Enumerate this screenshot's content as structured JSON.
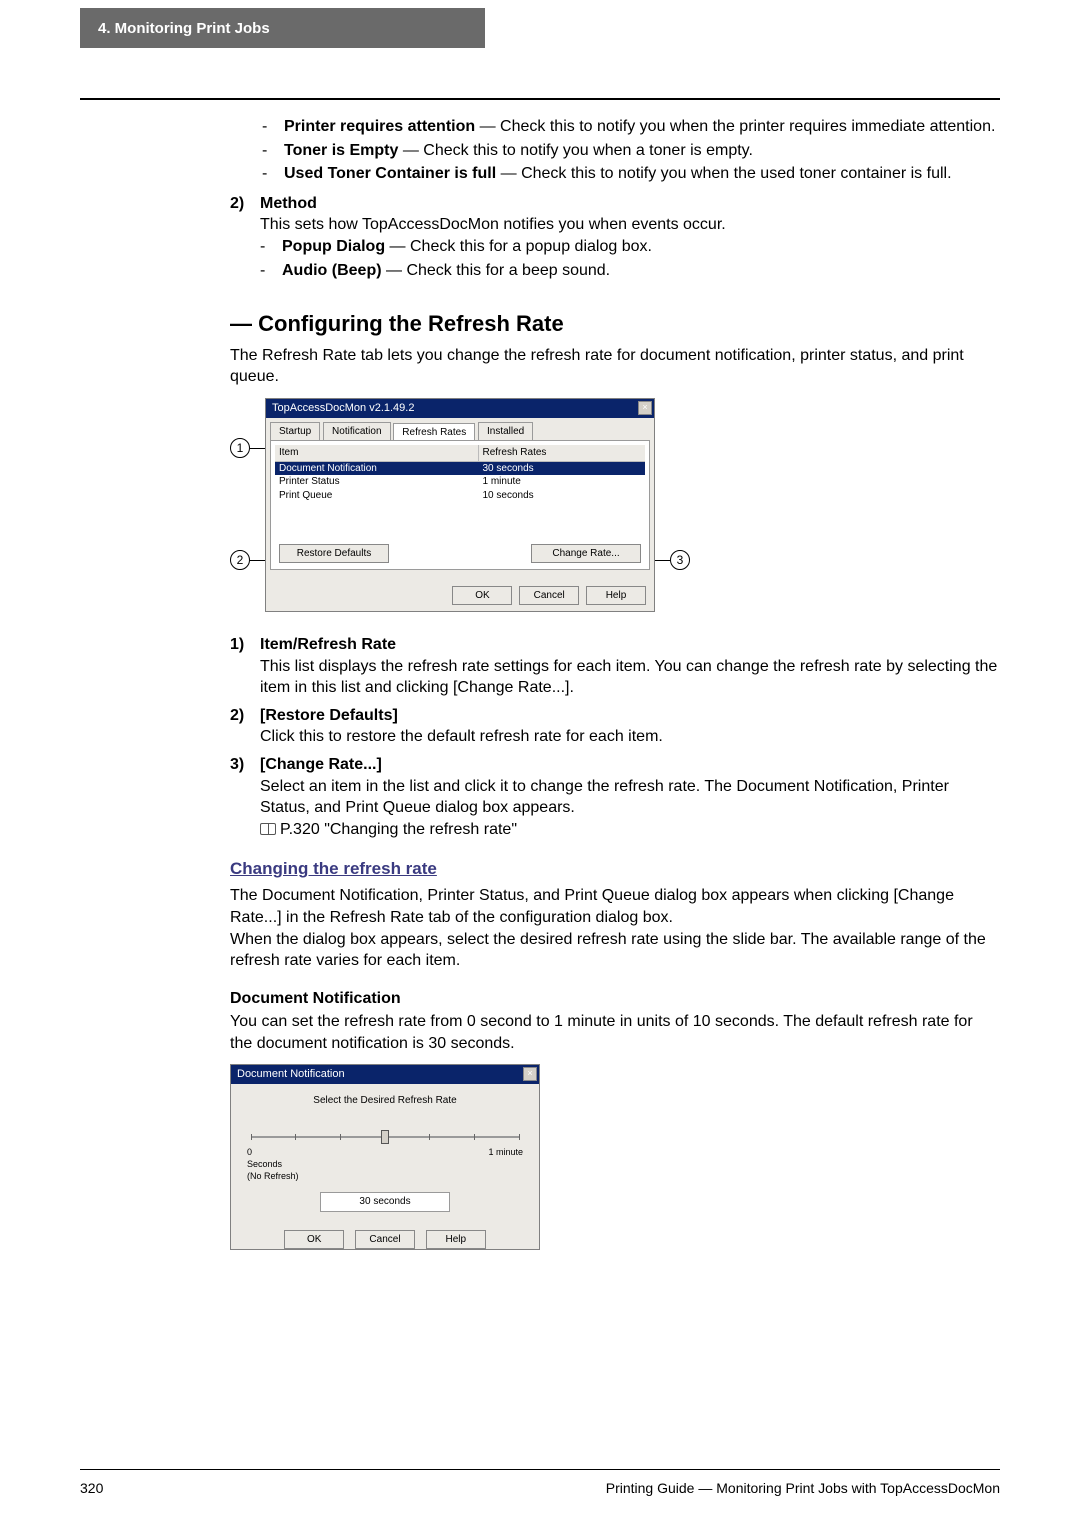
{
  "header": {
    "title": "4.  Monitoring Print Jobs"
  },
  "events": [
    {
      "label": "Printer requires attention",
      "desc": " — Check this to notify you when the printer requires immediate attention."
    },
    {
      "label": "Toner is Empty",
      "desc": " — Check this to notify you when a toner is empty."
    },
    {
      "label": "Used Toner Container is full",
      "desc": " — Check this to notify you when the used toner container is full."
    }
  ],
  "method": {
    "num": "2)",
    "title": "Method",
    "desc": "This sets how TopAccessDocMon notifies you when events occur.",
    "items": [
      {
        "label": "Popup Dialog",
        "desc": " — Check this for a popup dialog box."
      },
      {
        "label": "Audio (Beep)",
        "desc": " — Check this for a beep sound."
      }
    ]
  },
  "section2": {
    "heading": "— Configuring the Refresh Rate",
    "intro": "The Refresh Rate tab lets you change the refresh rate for document notification, printer status, and print queue."
  },
  "dlg1": {
    "title": "TopAccessDocMon  v2.1.49.2",
    "tabs": [
      "Startup",
      "Notification",
      "Refresh Rates",
      "Installed"
    ],
    "active_tab": 2,
    "col1": "Item",
    "col2": "Refresh Rates",
    "rows": [
      {
        "c1": "Document Notification",
        "c2": "30 seconds",
        "selected": true
      },
      {
        "c1": "Printer Status",
        "c2": "1 minute",
        "selected": false
      },
      {
        "c1": "Print Queue",
        "c2": "10 seconds",
        "selected": false
      }
    ],
    "restore": "Restore Defaults",
    "change": "Change Rate...",
    "ok": "OK",
    "cancel": "Cancel",
    "help": "Help",
    "callouts": {
      "c1": "1",
      "c2": "2",
      "c3": "3"
    }
  },
  "numbered": [
    {
      "n": "1)",
      "title": "Item/Refresh Rate",
      "body": "This list displays the refresh rate settings for each item.  You can change the refresh rate by selecting the item in this list and clicking [Change Rate...]."
    },
    {
      "n": "2)",
      "title": "[Restore Defaults]",
      "body": "Click this to restore the default refresh rate for each item."
    },
    {
      "n": "3)",
      "title": "[Change Rate...]",
      "body": "Select an item in the list and click it to change the refresh rate.  The Document Notification, Printer Status, and Print Queue dialog box appears.",
      "ref": "P.320 \"Changing the refresh rate\""
    }
  ],
  "changing": {
    "heading": "Changing the refresh rate",
    "p1": "The Document Notification, Printer Status, and Print Queue dialog box appears when clicking [Change Rate...] in the Refresh Rate tab of the configuration dialog box.",
    "p2": "When the dialog box appears, select the desired refresh rate using the slide bar.  The available range of the refresh rate varies for each item."
  },
  "docnotif": {
    "heading": "Document Notification",
    "body": "You can set the refresh rate from 0 second to 1 minute in units of 10 seconds.  The default refresh rate for the document notification is 30 seconds."
  },
  "dlg2": {
    "title": "Document Notification",
    "label": "Select the Desired Refresh Rate",
    "min": "0\nSeconds\n(No Refresh)",
    "max": "1 minute",
    "value": "30 seconds",
    "ok": "OK",
    "cancel": "Cancel",
    "help": "Help",
    "slider_pos_pct": 50
  },
  "chart_data": {
    "type": "table",
    "title": "Refresh Rates",
    "columns": [
      "Item",
      "Refresh Rates"
    ],
    "rows": [
      [
        "Document Notification",
        "30 seconds"
      ],
      [
        "Printer Status",
        "1 minute"
      ],
      [
        "Print Queue",
        "10 seconds"
      ]
    ]
  },
  "footer": {
    "page": "320",
    "text": "Printing Guide — Monitoring Print Jobs with TopAccessDocMon"
  }
}
